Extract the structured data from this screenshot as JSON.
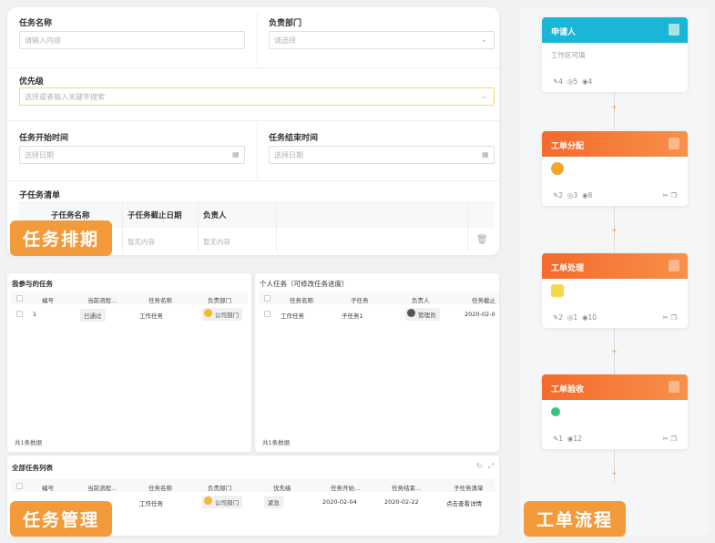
{
  "form": {
    "task_name_label": "任务名称",
    "task_name_placeholder": "请输入内容",
    "dept_label": "负责部门",
    "dept_placeholder": "请选择",
    "priority_label": "优先级",
    "priority_placeholder": "选择或者输入关键字搜索",
    "start_label": "任务开始时间",
    "start_placeholder": "选择日期",
    "end_label": "任务结束时间",
    "end_placeholder": "选择日期",
    "subtask_label": "子任务清单",
    "subtask_headers": [
      "子任务名称",
      "子任务截止日期",
      "负责人"
    ],
    "empty_text": "暂无内容"
  },
  "badges": {
    "schedule": "任务排期",
    "manage": "任务管理",
    "flow": "工单流程"
  },
  "my_tasks": {
    "title": "我参与的任务",
    "headers": [
      "编号",
      "当前流程...",
      "任务名称",
      "负责部门"
    ],
    "row": {
      "id": "1",
      "status": "已通过",
      "name": "工作任务",
      "dept": "公司部门"
    },
    "footer": "共1条数据"
  },
  "personal_tasks": {
    "title": "个人任务（可修改任务进度）",
    "headers": [
      "任务名称",
      "子任务",
      "负责人",
      "任务截止"
    ],
    "row": {
      "name": "工作任务",
      "sub": "子任务1",
      "owner": "管理员",
      "date": "2020-02-0"
    },
    "footer": "共1条数据"
  },
  "all_tasks": {
    "title": "全部任务列表",
    "headers": [
      "编号",
      "当前流程...",
      "任务名称",
      "负责部门",
      "优先级",
      "任务开始...",
      "任务结束...",
      "子任务清单"
    ],
    "row": {
      "name": "工作任务",
      "dept": "公司部门",
      "priority": "紧急",
      "start": "2020-02-04",
      "end": "2020-02-22",
      "detail": "点击查看详情"
    }
  },
  "flow": {
    "nodes": [
      {
        "title": "申请人",
        "sub": "工作区可填",
        "stats": [
          "4",
          "5",
          "4"
        ],
        "color": "#1ab6d8"
      },
      {
        "title": "工单分配",
        "stats": [
          "2",
          "3",
          "8"
        ],
        "color": "#f46a2c"
      },
      {
        "title": "工单处理",
        "stats": [
          "2",
          "1",
          "10"
        ],
        "color": "#f46a2c"
      },
      {
        "title": "工单验收",
        "stats": [
          "1",
          "12"
        ],
        "color": "#f46a2c"
      }
    ],
    "plus": "+"
  },
  "icons": {
    "calendar": "calendar-icon",
    "chevron": "chevron-down-icon",
    "trash": "trash-icon",
    "edit": "edit-icon",
    "eye": "eye-icon",
    "cut": "scissors-icon",
    "copy": "copy-icon",
    "refresh": "refresh-icon",
    "expand": "expand-icon"
  },
  "colors": {
    "accent": "#f39a3a",
    "cyan": "#1ab6d8",
    "orange": "#f46a2c"
  }
}
